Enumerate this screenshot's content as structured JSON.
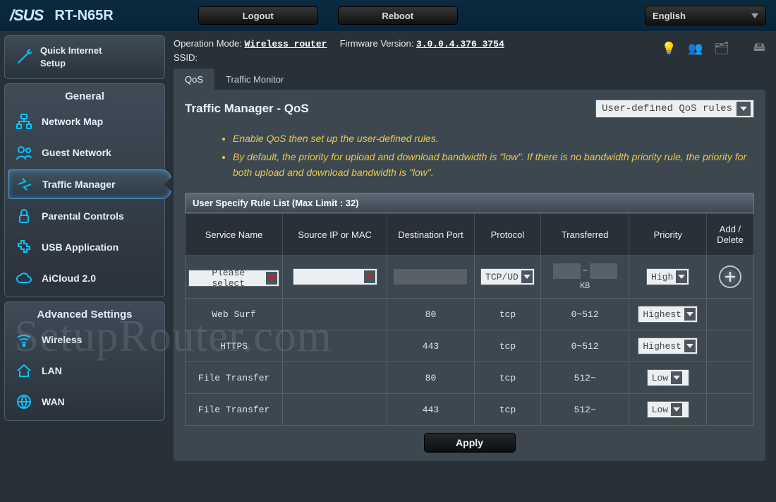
{
  "brand": "/SUS",
  "model": "RT-N65R",
  "top_buttons": {
    "logout": "Logout",
    "reboot": "Reboot"
  },
  "language": "English",
  "info": {
    "op_mode_label": "Operation Mode:",
    "op_mode_value": "Wireless router",
    "fw_label": "Firmware Version:",
    "fw_value": "3.0.0.4.376_3754",
    "ssid_label": "SSID:"
  },
  "wizard": {
    "line1": "Quick Internet",
    "line2": "Setup"
  },
  "sidebar": {
    "general_header": "General",
    "general_items": [
      "Network Map",
      "Guest Network",
      "Traffic Manager",
      "Parental Controls",
      "USB Application",
      "AiCloud 2.0"
    ],
    "advanced_header": "Advanced Settings",
    "advanced_items": [
      "Wireless",
      "LAN",
      "WAN"
    ]
  },
  "tabs": [
    "QoS",
    "Traffic Monitor"
  ],
  "panel_title": "Traffic Manager - QoS",
  "rule_select": "User-defined QoS rules",
  "hints": [
    "Enable QoS then set up the user-defined rules.",
    "By default, the priority for upload and download bandwidth is \"low\". If there is no bandwidth priority rule, the priority for both upload and download bandwidth is \"low\"."
  ],
  "table": {
    "caption": "User Specify Rule List (Max Limit : 32)",
    "headers": [
      "Service Name",
      "Source IP or MAC",
      "Destination Port",
      "Protocol",
      "Transferred",
      "Priority",
      "Add / Delete"
    ],
    "input_row": {
      "service": "Please select",
      "protocol": "TCP/UD",
      "kb_label": "KB",
      "priority": "High",
      "tilde": "~"
    },
    "rows": [
      {
        "service": "Web Surf",
        "src": "",
        "port": "80",
        "proto": "tcp",
        "transferred": "0~512",
        "priority": "Highest"
      },
      {
        "service": "HTTPS",
        "src": "",
        "port": "443",
        "proto": "tcp",
        "transferred": "0~512",
        "priority": "Highest"
      },
      {
        "service": "File Transfer",
        "src": "",
        "port": "80",
        "proto": "tcp",
        "transferred": "512~",
        "priority": "Low"
      },
      {
        "service": "File Transfer",
        "src": "",
        "port": "443",
        "proto": "tcp",
        "transferred": "512~",
        "priority": "Low"
      }
    ]
  },
  "apply_label": "Apply",
  "watermark": "SetupRouter.com"
}
